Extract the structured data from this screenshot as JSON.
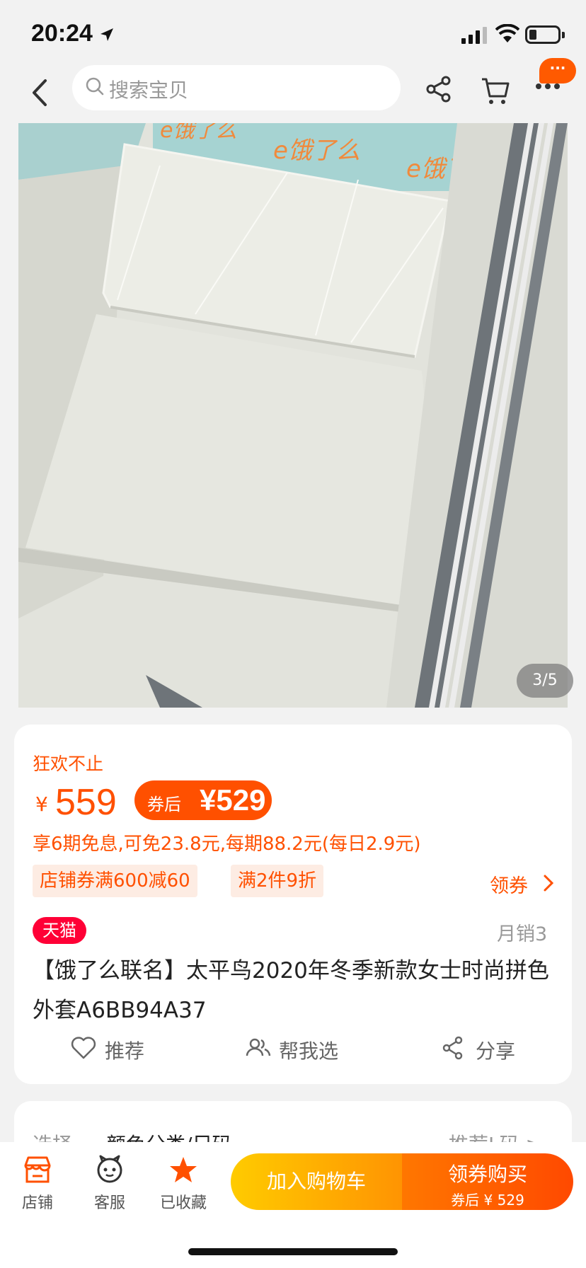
{
  "status_bar": {
    "time": "20:24"
  },
  "nav": {
    "search_placeholder": "搜索宝贝",
    "message_badge": "···"
  },
  "gallery": {
    "page_indicator": "3/5",
    "logo_text": "e饿了么"
  },
  "product": {
    "promo_label": "狂欢不止",
    "currency": "¥",
    "price": "559",
    "coupon_label": "券后",
    "coupon_price": "¥529",
    "installment": "享6期免息,可免23.8元,每期88.2元(每日2.9元)",
    "tags": [
      "店铺券满600减60",
      "满2件9折"
    ],
    "get_coupon": "领券",
    "tmall": "天猫",
    "monthly_sales": "月销3",
    "title": "【饿了么联名】太平鸟2020年冬季新款女士时尚拼色外套A6BB94A37",
    "actions": [
      "推荐",
      "帮我选",
      "分享"
    ]
  },
  "options": {
    "label": "选择",
    "value": "颜色分类/尺码",
    "hint": "推荐L码 >"
  },
  "bottom_bar": {
    "items": [
      "店铺",
      "客服",
      "已收藏"
    ],
    "add_to_cart": "加入购物车",
    "buy_title": "领券购买",
    "buy_sub": "券后 ¥ 529"
  },
  "colors": {
    "accent": "#ff5000",
    "tmall": "#ff0036"
  }
}
